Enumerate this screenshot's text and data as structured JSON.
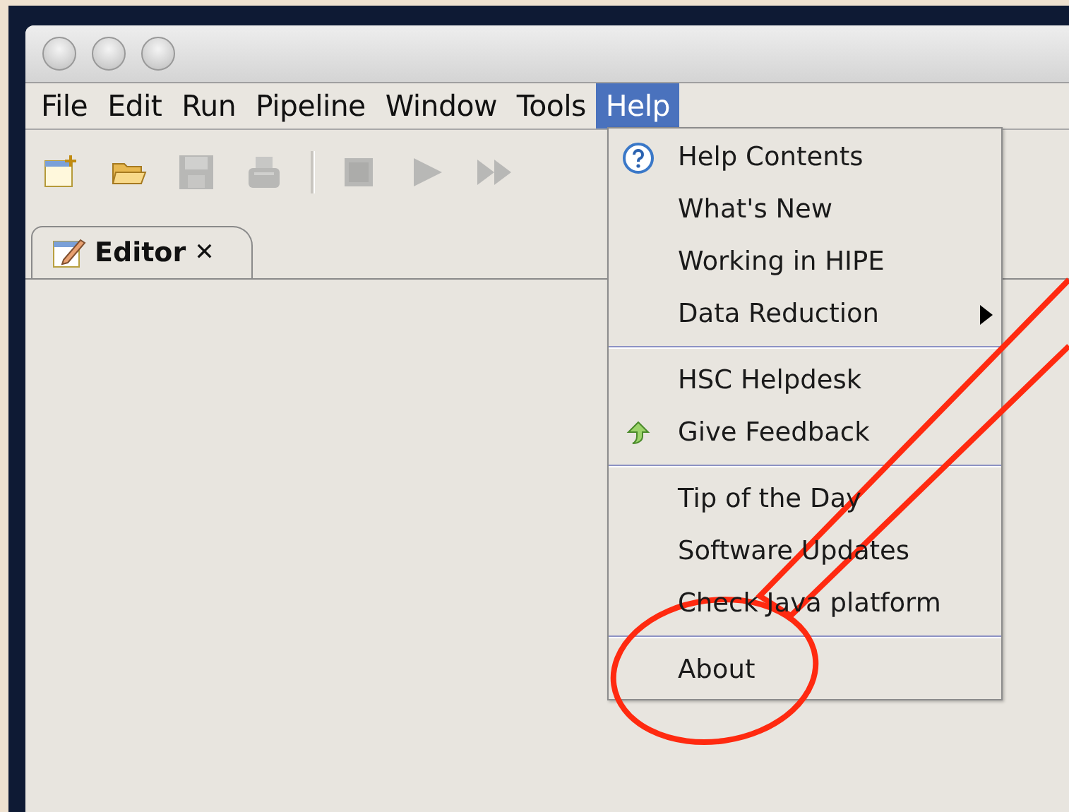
{
  "menu_bar": [
    {
      "label": "File",
      "selected": false
    },
    {
      "label": "Edit",
      "selected": false
    },
    {
      "label": "Run",
      "selected": false
    },
    {
      "label": "Pipeline",
      "selected": false
    },
    {
      "label": "Window",
      "selected": false
    },
    {
      "label": "Tools",
      "selected": false
    },
    {
      "label": "Help",
      "selected": true
    }
  ],
  "toolbar": [
    [
      {
        "kind": "new",
        "disabled": false
      },
      {
        "kind": "open",
        "disabled": false
      },
      {
        "kind": "save",
        "disabled": true
      },
      {
        "kind": "print",
        "disabled": true
      }
    ],
    [
      {
        "kind": "stop",
        "disabled": true
      },
      {
        "kind": "run",
        "disabled": true
      },
      {
        "kind": "run-all",
        "disabled": true
      }
    ]
  ],
  "tabs": [
    {
      "label": "Editor",
      "close": "✕",
      "selected": true
    }
  ],
  "help_menu": {
    "groups": [
      [
        {
          "label": "Help Contents",
          "kind": "help"
        },
        {
          "label": "What's New",
          "kind": "plain"
        },
        {
          "label": "Working in HIPE",
          "kind": "plain"
        },
        {
          "label": "Data Reduction",
          "kind": "submenu"
        }
      ],
      [
        {
          "label": "HSC Helpdesk",
          "kind": "plain"
        },
        {
          "label": "Give Feedback",
          "kind": "feedback"
        }
      ],
      [
        {
          "label": "Tip of the Day",
          "kind": "plain"
        },
        {
          "label": "Software Updates",
          "kind": "plain"
        },
        {
          "label": "Check Java platform",
          "kind": "plain"
        }
      ],
      [
        {
          "label": "About",
          "kind": "plain"
        }
      ]
    ]
  }
}
